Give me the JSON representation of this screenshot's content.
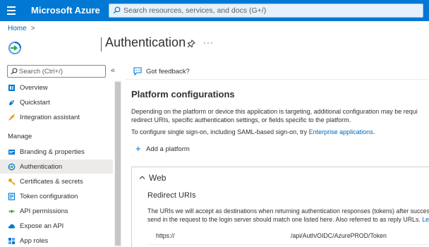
{
  "topbar": {
    "brand": "Microsoft Azure",
    "search_placeholder": "Search resources, services, and docs (G+/)"
  },
  "breadcrumb": {
    "home": "Home",
    "separator": ">"
  },
  "header": {
    "title": "Authentication",
    "more": "···"
  },
  "nav": {
    "search_placeholder": "Search (Ctrl+/)",
    "collapse": "«",
    "items_top": [
      {
        "label": "Overview",
        "icon": "overview-icon"
      },
      {
        "label": "Quickstart",
        "icon": "quickstart-icon"
      },
      {
        "label": "Integration assistant",
        "icon": "rocket-icon"
      }
    ],
    "section_manage": "Manage",
    "items_manage": [
      {
        "label": "Branding & properties",
        "icon": "branding-icon"
      },
      {
        "label": "Authentication",
        "icon": "authentication-icon",
        "active": true
      },
      {
        "label": "Certificates & secrets",
        "icon": "key-icon"
      },
      {
        "label": "Token configuration",
        "icon": "token-icon"
      },
      {
        "label": "API permissions",
        "icon": "api-permissions-icon"
      },
      {
        "label": "Expose an API",
        "icon": "cloud-icon"
      },
      {
        "label": "App roles",
        "icon": "app-roles-icon"
      }
    ]
  },
  "main": {
    "feedback": "Got feedback?",
    "platform_heading": "Platform configurations",
    "platform_desc_line1": "Depending on the platform or device this application is targeting, additional configuration may be requi",
    "platform_desc_line2": "redirect URIs, specific authentication settings, or fields specific to the platform.",
    "sso_text": "To configure single sign-on, including SAML-based sign-on, try ",
    "sso_link": "Enterprise applications",
    "sso_end": ".",
    "add_platform": "Add a platform",
    "web": {
      "heading": "Web",
      "redirect_heading": "Redirect URIs",
      "desc_line1": "The URIs we will accept as destinations when returning authentication responses (tokens) after successfu",
      "desc_line2": "send in the request to the login server should match one listed here. Also referred to as reply URLs. ",
      "desc_link": "Lear",
      "uri_start": "https://",
      "uri_end": "/api/Auth/OIDC/AzurePROD/Token"
    }
  },
  "colors": {
    "accent": "#0078d4",
    "link": "#0064b4",
    "active_bg": "#edebe9"
  }
}
